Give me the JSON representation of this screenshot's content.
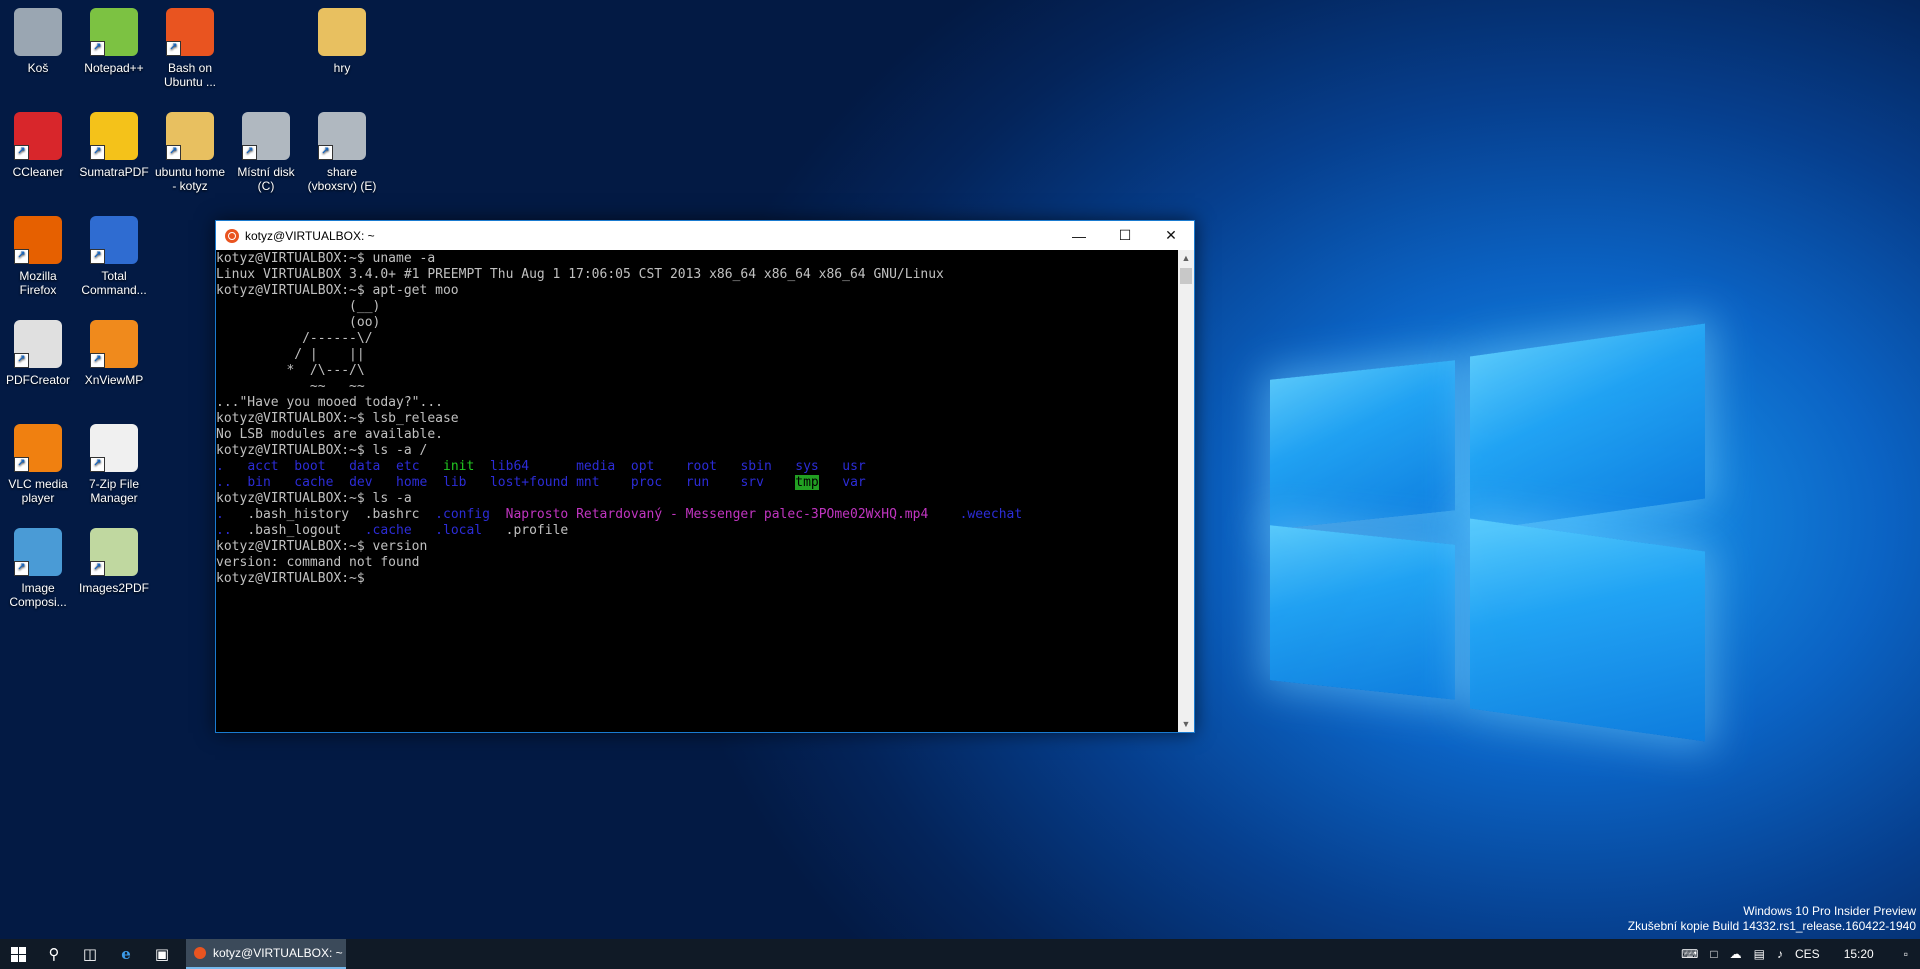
{
  "desktop_icons": [
    {
      "label": "Koš",
      "icon": "recycle-bin-icon",
      "color": "#9aa6b2"
    },
    {
      "label": "Notepad++",
      "icon": "notepadpp-icon",
      "color": "#7cc242"
    },
    {
      "label": "Bash on Ubuntu ...",
      "icon": "ubuntu-icon",
      "color": "#e95420"
    },
    {
      "label": "hry",
      "icon": "folder-icon",
      "color": "#e8c060"
    },
    {
      "label": "CCleaner",
      "icon": "ccleaner-icon",
      "color": "#d8262b"
    },
    {
      "label": "SumatraPDF",
      "icon": "sumatrapdf-icon",
      "color": "#f4c21a"
    },
    {
      "label": "ubuntu home - kotyz",
      "icon": "folder-icon",
      "color": "#e8c060"
    },
    {
      "label": "Místní disk (C)",
      "icon": "local-disk-icon",
      "color": "#b0b8c0"
    },
    {
      "label": "share (vboxsrv) (E)",
      "icon": "network-drive-icon",
      "color": "#b0b8c0"
    },
    {
      "label": "Mozilla Firefox",
      "icon": "firefox-icon",
      "color": "#e66000"
    },
    {
      "label": "Total Command...",
      "icon": "total-commander-icon",
      "color": "#2f6cd1"
    },
    {
      "label": "PDFCreator",
      "icon": "pdfcreator-icon",
      "color": "#e0e0e0"
    },
    {
      "label": "XnViewMP",
      "icon": "xnviewmp-icon",
      "color": "#f08a1c"
    },
    {
      "label": "VLC media player",
      "icon": "vlc-icon",
      "color": "#f08010"
    },
    {
      "label": "7-Zip File Manager",
      "icon": "7zip-icon",
      "color": "#f0f0f0"
    },
    {
      "label": "Image Composi...",
      "icon": "image-composite-icon",
      "color": "#4a9bd6"
    },
    {
      "label": "Images2PDF",
      "icon": "images2pdf-icon",
      "color": "#c0d8a0"
    }
  ],
  "terminal": {
    "title": "kotyz@VIRTUALBOX: ~",
    "lines": [
      "kotyz@VIRTUALBOX:~$ uname -a",
      "Linux VIRTUALBOX 3.4.0+ #1 PREEMPT Thu Aug 1 17:06:05 CST 2013 x86_64 x86_64 x86_64 GNU/Linux",
      "kotyz@VIRTUALBOX:~$ apt-get moo",
      "                 (__)",
      "                 (oo)",
      "           /------\\/",
      "          / |    ||",
      "         *  /\\---/\\",
      "            ~~   ~~",
      "...\"Have you mooed today?\"...",
      "kotyz@VIRTUALBOX:~$ lsb_release",
      "No LSB modules are available.",
      "kotyz@VIRTUALBOX:~$ ls -a /"
    ],
    "ls_root_row1": [
      ".",
      "acct",
      "boot",
      "data",
      "etc",
      "init",
      "lib64",
      "media",
      "opt",
      "root",
      "sbin",
      "sys",
      "usr"
    ],
    "ls_root_row2": [
      "..",
      "bin",
      "cache",
      "dev",
      "home",
      "lib",
      "lost+found",
      "mnt",
      "proc",
      "run",
      "srv",
      "tmp",
      "var"
    ],
    "prompt_ls_home": "kotyz@VIRTUALBOX:~$ ls -a",
    "ls_home_row1": [
      ".",
      ".bash_history",
      ".bashrc",
      ".config",
      "Naprosto Retardovaný - Messenger palec-3POme02WxHQ.mp4",
      ".weechat"
    ],
    "ls_home_row2": [
      "..",
      ".bash_logout",
      ".cache",
      ".local",
      ".profile"
    ],
    "tail_lines": [
      "kotyz@VIRTUALBOX:~$ version",
      "version: command not found",
      "kotyz@VIRTUALBOX:~$"
    ]
  },
  "watermark": {
    "line1": "Windows 10 Pro Insider Preview",
    "line2": "Zkušební kopie Build 14332.rs1_release.160422-1940"
  },
  "taskbar": {
    "task_label": "kotyz@VIRTUALBOX: ~",
    "language": "CES",
    "time": "15:20"
  }
}
